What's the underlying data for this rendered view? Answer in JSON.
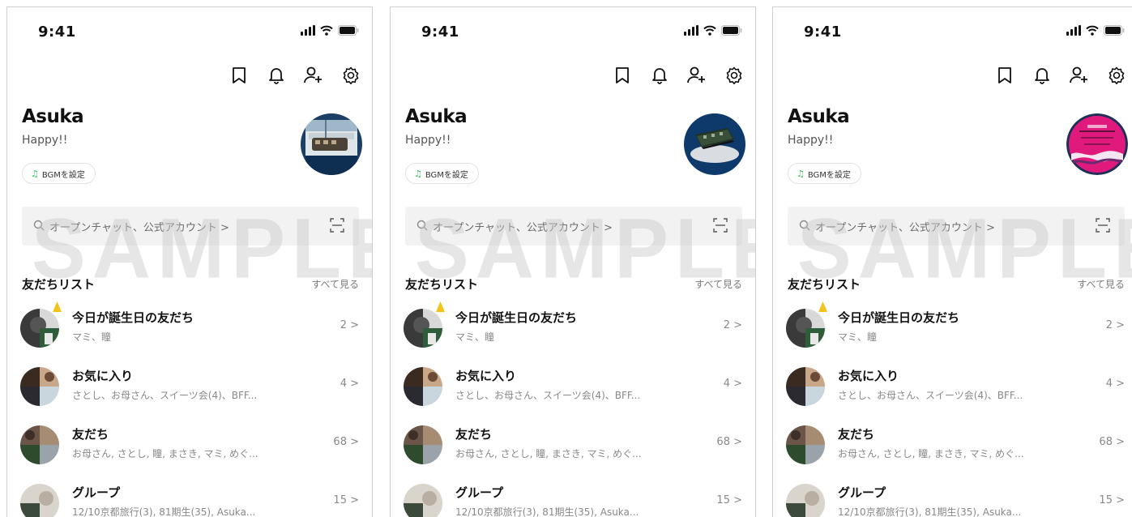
{
  "status": {
    "time": "9:41"
  },
  "toolbar": {
    "icons": [
      "bookmark-icon",
      "bell-icon",
      "add-friend-icon",
      "gear-icon"
    ]
  },
  "profile": {
    "name": "Asuka",
    "status_message": "Happy!!",
    "bgm_label": "BGMを設定"
  },
  "search": {
    "text": "オープンチャット、公式アカウント >"
  },
  "watermark": "SAMPLE",
  "friends_section": {
    "title": "友だちリスト",
    "see_all": "すべて見る",
    "rows": [
      {
        "title": "今日が誕生日の友だち",
        "subtitle": "マミ、瞳",
        "count": "2 >"
      },
      {
        "title": "お気に入り",
        "subtitle": "さとし、お母さん、スイーツ会(4)、BFF...",
        "count": "4 >"
      },
      {
        "title": "友だち",
        "subtitle": "お母さん, さとし, 瞳, まさき, マミ, めぐ...",
        "count": "68 >"
      },
      {
        "title": "グループ",
        "subtitle": "12/10京都旅行(3), 81期生(35), Asuka...",
        "count": "15 >"
      }
    ]
  },
  "screens": [
    {
      "avatar": "train-photo-avatar"
    },
    {
      "avatar": "train-model-avatar"
    },
    {
      "avatar": "pink-logo-avatar"
    }
  ],
  "colors": {
    "accent_green": "#2ec15a",
    "search_bg": "#f2f2f2",
    "muted_text": "#888888",
    "logo_pink": "#e0197d"
  }
}
